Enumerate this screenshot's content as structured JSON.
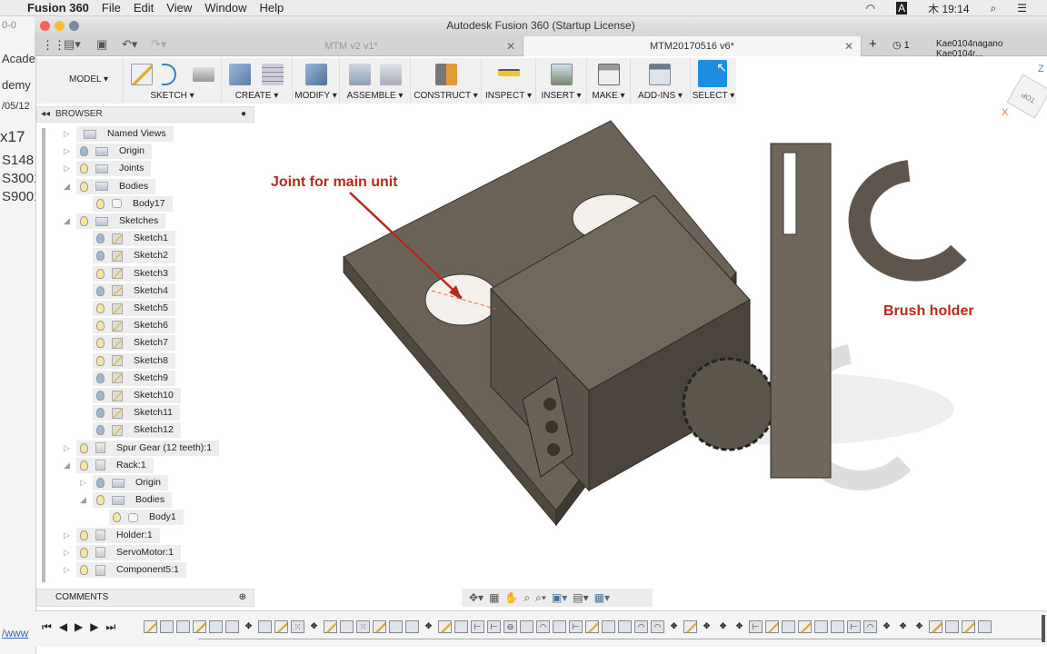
{
  "menubar": {
    "app": "Fusion 360",
    "items": [
      "File",
      "Edit",
      "View",
      "Window",
      "Help"
    ],
    "clock": "木 19:14",
    "input_indicator": "A"
  },
  "background_window": {
    "texts": [
      "0-0",
      "Acaden",
      "demy",
      "/05/12",
      "x17",
      "S148",
      "S3001",
      "S9001",
      "/www"
    ]
  },
  "window": {
    "title": "Autodesk Fusion 360 (Startup License)"
  },
  "tabs": [
    {
      "label": "MTM v2 v1*",
      "active": false
    },
    {
      "label": "MTM20170516 v6*",
      "active": true
    }
  ],
  "tabbar": {
    "jobs_count": "1",
    "user": "Kae0104nagano Kae0104r..."
  },
  "toolbar": {
    "workspace": "MODEL ▾",
    "groups": [
      "SKETCH ▾",
      "CREATE ▾",
      "MODIFY ▾",
      "ASSEMBLE ▾",
      "CONSTRUCT ▾",
      "INSPECT ▾",
      "INSERT ▾",
      "MAKE ▾",
      "ADD-INS ▾",
      "SELECT ▾"
    ]
  },
  "browser": {
    "title": "BROWSER",
    "items": [
      {
        "label": "Named Views",
        "indent": 0,
        "expander": "collapsed",
        "bulb": null,
        "icon": "folder"
      },
      {
        "label": "Origin",
        "indent": 0,
        "expander": "collapsed",
        "bulb": "off",
        "icon": "folder"
      },
      {
        "label": "Joints",
        "indent": 0,
        "expander": "collapsed",
        "bulb": "on",
        "icon": "folder"
      },
      {
        "label": "Bodies",
        "indent": 0,
        "expander": "expanded",
        "bulb": "on",
        "icon": "folder"
      },
      {
        "label": "Body17",
        "indent": 1,
        "expander": null,
        "bulb": "on",
        "icon": "body"
      },
      {
        "label": "Sketches",
        "indent": 0,
        "expander": "expanded",
        "bulb": "on",
        "icon": "folder"
      },
      {
        "label": "Sketch1",
        "indent": 1,
        "expander": null,
        "bulb": "off",
        "icon": "sketch"
      },
      {
        "label": "Sketch2",
        "indent": 1,
        "expander": null,
        "bulb": "off",
        "icon": "sketch"
      },
      {
        "label": "Sketch3",
        "indent": 1,
        "expander": null,
        "bulb": "on",
        "icon": "sketch"
      },
      {
        "label": "Sketch4",
        "indent": 1,
        "expander": null,
        "bulb": "off",
        "icon": "sketch"
      },
      {
        "label": "Sketch5",
        "indent": 1,
        "expander": null,
        "bulb": "on",
        "icon": "sketch"
      },
      {
        "label": "Sketch6",
        "indent": 1,
        "expander": null,
        "bulb": "on",
        "icon": "sketch"
      },
      {
        "label": "Sketch7",
        "indent": 1,
        "expander": null,
        "bulb": "on",
        "icon": "sketch"
      },
      {
        "label": "Sketch8",
        "indent": 1,
        "expander": null,
        "bulb": "on",
        "icon": "sketch"
      },
      {
        "label": "Sketch9",
        "indent": 1,
        "expander": null,
        "bulb": "off",
        "icon": "sketch"
      },
      {
        "label": "Sketch10",
        "indent": 1,
        "expander": null,
        "bulb": "off",
        "icon": "sketch"
      },
      {
        "label": "Sketch11",
        "indent": 1,
        "expander": null,
        "bulb": "off",
        "icon": "sketch"
      },
      {
        "label": "Sketch12",
        "indent": 1,
        "expander": null,
        "bulb": "off",
        "icon": "sketch"
      },
      {
        "label": "Spur Gear (12 teeth):1",
        "indent": 0,
        "expander": "collapsed",
        "bulb": "on",
        "icon": "comp"
      },
      {
        "label": "Rack:1",
        "indent": 0,
        "expander": "expanded",
        "bulb": "on",
        "icon": "comp"
      },
      {
        "label": "Origin",
        "indent": 1,
        "expander": "collapsed",
        "bulb": "off",
        "icon": "folder"
      },
      {
        "label": "Bodies",
        "indent": 1,
        "expander": "expanded",
        "bulb": "on",
        "icon": "folder"
      },
      {
        "label": "Body1",
        "indent": 2,
        "expander": null,
        "bulb": "on",
        "icon": "body"
      },
      {
        "label": "Holder:1",
        "indent": 0,
        "expander": "collapsed",
        "bulb": "on",
        "icon": "comp"
      },
      {
        "label": "ServoMotor:1",
        "indent": 0,
        "expander": "collapsed",
        "bulb": "on",
        "icon": "comp"
      },
      {
        "label": "Component5:1",
        "indent": 0,
        "expander": "collapsed",
        "bulb": "on",
        "icon": "comp"
      }
    ]
  },
  "comments": {
    "title": "COMMENTS"
  },
  "viewport": {
    "annotations": [
      "Joint for main unit",
      "Brush holder"
    ],
    "annotation_color": "#b52a1c",
    "viewcube_face": "TOP",
    "axis_labels": [
      "Z",
      "X"
    ]
  },
  "timeline": {
    "features": [
      "sketch",
      "body",
      "body",
      "sketch",
      "body",
      "body",
      "joint",
      "body",
      "sketch",
      "pattern",
      "joint",
      "sketch",
      "body",
      "pattern",
      "sketch",
      "body",
      "body",
      "joint",
      "sketch",
      "body",
      "split",
      "split",
      "hole",
      "body",
      "fillet",
      "body",
      "split",
      "sketch",
      "body",
      "body",
      "fillet",
      "fillet",
      "joint",
      "sketch",
      "joint",
      "joint",
      "joint",
      "split",
      "sketch",
      "body",
      "sketch",
      "body",
      "body",
      "split",
      "fillet",
      "joint",
      "joint",
      "joint",
      "sketch",
      "body",
      "sketch",
      "body"
    ]
  },
  "colors": {
    "accent": "#1b8ee0",
    "model": "#5e564c"
  }
}
